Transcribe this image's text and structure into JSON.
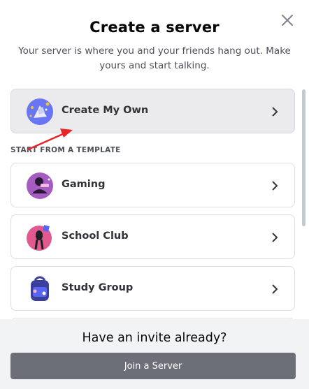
{
  "modal": {
    "title": "Create a server",
    "subtitle": "Your server is where you and your friends hang out. Make yours and start talking."
  },
  "create_own": {
    "label": "Create My Own",
    "icon": "create-my-own-icon"
  },
  "templates": {
    "section_label": "START FROM A TEMPLATE",
    "items": [
      {
        "label": "Gaming",
        "icon": "gaming-icon"
      },
      {
        "label": "School Club",
        "icon": "school-club-icon"
      },
      {
        "label": "Study Group",
        "icon": "study-group-icon"
      }
    ]
  },
  "footer": {
    "title": "Have an invite already?",
    "join_label": "Join a Server"
  },
  "colors": {
    "annotation_arrow": "#e8262a",
    "join_button": "#6d6f78",
    "footer_bg": "#f2f3f5"
  }
}
